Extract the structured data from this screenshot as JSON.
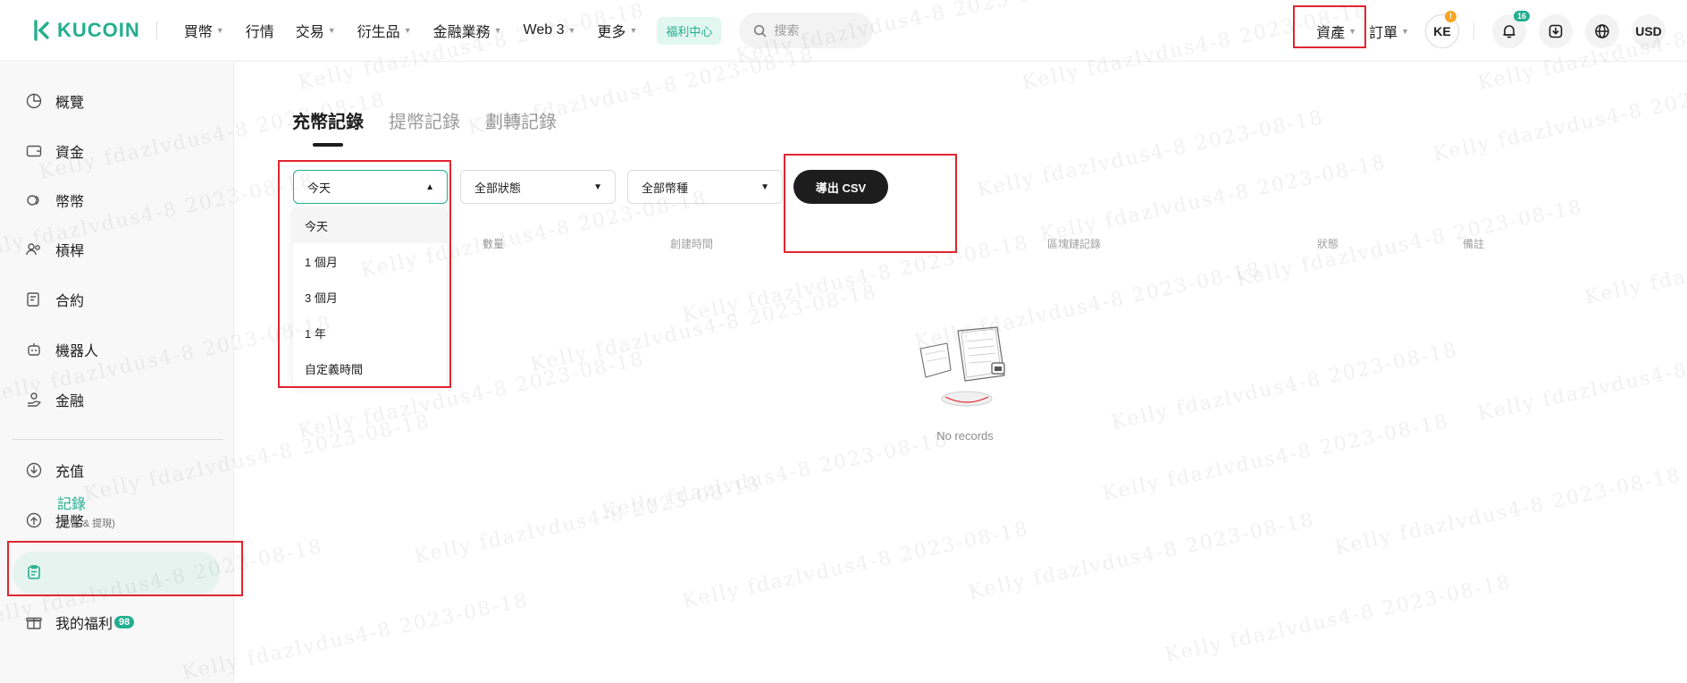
{
  "brand": {
    "name": "KUCOIN",
    "color": "#24ae8f"
  },
  "nav": {
    "items": [
      {
        "label": "買幣",
        "caret": true
      },
      {
        "label": "行情",
        "caret": false
      },
      {
        "label": "交易",
        "caret": true
      },
      {
        "label": "衍生品",
        "caret": true
      },
      {
        "label": "金融業務",
        "caret": true
      },
      {
        "label": "Web 3",
        "caret": true
      },
      {
        "label": "更多",
        "caret": true
      }
    ],
    "welfare": "福利中心"
  },
  "search": {
    "placeholder": "搜索",
    "icon": "search-icon"
  },
  "header_right": {
    "assets": "資產",
    "orders": "訂單",
    "avatar": "KE",
    "avatar_alert": "!",
    "notifications_count": "16",
    "currency": "USD"
  },
  "sidebar": {
    "items": [
      {
        "label": "概覽",
        "icon": "pie-chart-icon"
      },
      {
        "label": "資金",
        "icon": "wallet-icon"
      },
      {
        "label": "幣幣",
        "icon": "coins-icon"
      },
      {
        "label": "槓桿",
        "icon": "people-icon"
      },
      {
        "label": "合約",
        "icon": "contract-icon"
      },
      {
        "label": "機器人",
        "icon": "robot-icon"
      },
      {
        "label": "金融",
        "icon": "hand-coin-icon"
      }
    ],
    "secondary": [
      {
        "label": "充值",
        "icon": "deposit-icon"
      },
      {
        "label": "提幣",
        "icon": "withdraw-icon"
      }
    ],
    "active": {
      "label": "記錄",
      "sub": "(充值 & 提現)",
      "icon": "clipboard-icon"
    },
    "benefit": {
      "label": "我的福利",
      "badge": "98",
      "icon": "gift-icon"
    }
  },
  "tabs": [
    "充幣記錄",
    "提幣記錄",
    "劃轉記錄"
  ],
  "filters": {
    "time": "今天",
    "status": "全部狀態",
    "coin": "全部幣種",
    "export": "導出 CSV"
  },
  "columns": [
    "數量",
    "創建時間",
    "區塊鏈記錄",
    "狀態",
    "備註"
  ],
  "dropdown": {
    "options": [
      "今天",
      "1 個月",
      "3 個月",
      "1 年",
      "自定義時間"
    ],
    "selected": 0
  },
  "empty": {
    "text": "No records"
  },
  "watermark": "Kelly fdazlvdus4-8 2023-08-18"
}
